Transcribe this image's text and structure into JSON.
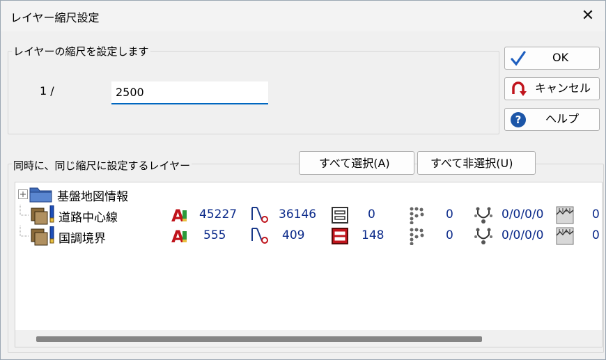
{
  "window": {
    "title": "レイヤー縮尺設定",
    "close_glyph": "✕"
  },
  "scale_group": {
    "label": "レイヤーの縮尺を設定します",
    "prefix": "1 /",
    "value": "2500"
  },
  "buttons": {
    "ok": "OK",
    "cancel": "キャンセル",
    "help": "ヘルプ"
  },
  "layers_group": {
    "label": "同時に、同じ縮尺に設定するレイヤー",
    "select_all": "すべて選択(A)",
    "deselect_all": "すべて非選択(U)",
    "tree": {
      "root": "基盤地図情報",
      "items": [
        {
          "name": "道路中心線",
          "annotations": "45227",
          "lines": "36146",
          "polygons": "0",
          "points": "0",
          "nodes": "0/0/0/0",
          "surfaces": "0",
          "polygon_active": false
        },
        {
          "name": "国調境界",
          "annotations": "555",
          "lines": "409",
          "polygons": "148",
          "points": "0",
          "nodes": "0/0/0/0",
          "surfaces": "0",
          "polygon_active": true
        }
      ]
    }
  },
  "colors": {
    "accent": "#0067c0",
    "count_text": "#0b2a8a",
    "icon_red": "#c0141c",
    "ok_check": "#1f5fbf"
  }
}
